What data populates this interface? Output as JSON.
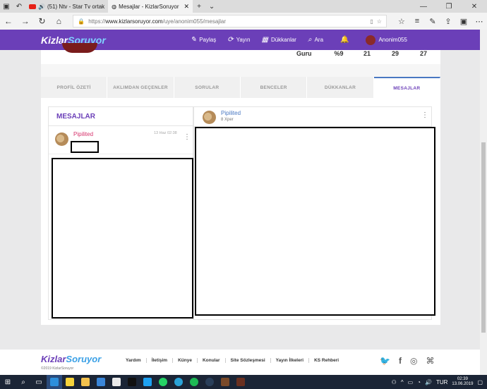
{
  "browser": {
    "tabs": [
      {
        "label": "(51) Ntv - Star Tv ortak",
        "active": false
      },
      {
        "label": "Mesajlar - KizlarSoruyor",
        "active": true
      }
    ],
    "url_prefix": "https://",
    "url_domain": "www.kizlarsoruyor.com",
    "url_path": "/uye/anonim055/mesajlar"
  },
  "site": {
    "logo_main": "Kizlar",
    "logo_accent": "Soruyor",
    "menu": [
      {
        "label": "Paylaş",
        "icon": "pencil-icon"
      },
      {
        "label": "Yayın",
        "icon": "refresh-icon"
      },
      {
        "label": "Dükkanlar",
        "icon": "store-icon"
      },
      {
        "label": "Ara",
        "icon": "search-icon"
      }
    ],
    "username": "Anonim055"
  },
  "profile": {
    "stats": [
      "Guru",
      "%9",
      "21",
      "29",
      "27"
    ],
    "tabs": [
      "PROFİL ÖZETİ",
      "AKLIMDAN GEÇENLER",
      "SORULAR",
      "BENCELER",
      "DÜKKANLAR",
      "MESAJLAR"
    ],
    "active_tab": "MESAJLAR"
  },
  "messages": {
    "title": "MESAJLAR",
    "conversations": [
      {
        "name": "Pipilited",
        "date": "13 Haz 02:38"
      }
    ]
  },
  "chat": {
    "name": "Pipilited",
    "subtitle": "8 Xper"
  },
  "footer": {
    "links": [
      "Yardım",
      "İletişim",
      "Künye",
      "Konular",
      "Site Sözleşmesi",
      "Yayın İlkeleri",
      "KS Rehberi"
    ],
    "copyright": "©2019 KizlarSoruyor"
  },
  "taskbar": {
    "time": "02:39",
    "date": "13.06.2019",
    "lang": "TUR"
  },
  "colors": {
    "brand": "#6b3fb8",
    "name_pink": "#d6336c",
    "name_blue": "#4a78c2"
  }
}
